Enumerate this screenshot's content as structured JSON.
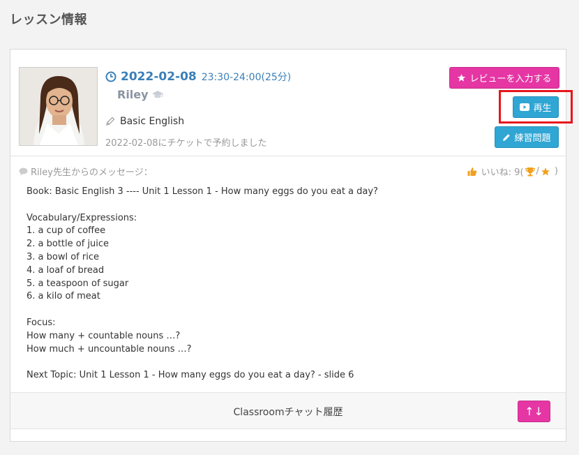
{
  "page": {
    "title": "レッスン情報"
  },
  "lesson": {
    "date": "2022-02-08",
    "time": "23:30-24:00(25分)",
    "teacher": "Riley",
    "course": "Basic English",
    "booking_note": "2022-02-08にチケットで予約しました"
  },
  "buttons": {
    "review": "レビューを入力する",
    "play": "再生",
    "exercise": "練習問題",
    "toggle": "↑↓"
  },
  "message": {
    "header": "Riley先生からのメッセージ：",
    "likes_label": "いいね: 9(",
    "likes_close": ")",
    "likes_sep": "/",
    "body": "Book: Basic English 3 ---- Unit 1 Lesson 1 - How many eggs do you eat a day?\n\nVocabulary/Expressions:\n1. a cup of coffee\n2. a bottle of juice\n3. a bowl of rice\n4. a loaf of bread\n5. a teaspoon of sugar\n6. a kilo of meat\n\nFocus:\nHow many + countable nouns …?\nHow much + uncountable nouns …?\n\nNext Topic: Unit 1 Lesson 1 - How many eggs do you eat a day? - slide 6"
  },
  "footer": {
    "label": "Classroomチャット履歴"
  },
  "colors": {
    "accent_blue": "#3a7fb8",
    "pink": "#e536a4",
    "cyan": "#2fa6d4",
    "highlight": "#e8151b",
    "like_orange": "#f0a020"
  }
}
